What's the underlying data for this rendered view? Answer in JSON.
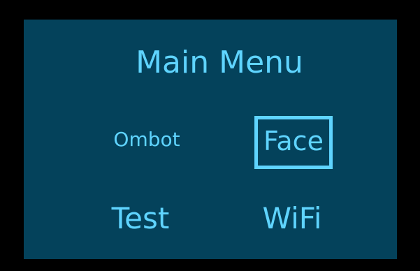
{
  "menu": {
    "title": "Main Menu",
    "items": [
      {
        "label": "Ombot",
        "selected": false
      },
      {
        "label": "Face",
        "selected": true
      },
      {
        "label": "Test",
        "selected": false
      },
      {
        "label": "WiFi",
        "selected": false
      }
    ]
  },
  "colors": {
    "background": "#000000",
    "screen": "#04425b",
    "text": "#5fd4ff",
    "selection_border": "#5fd4ff"
  }
}
